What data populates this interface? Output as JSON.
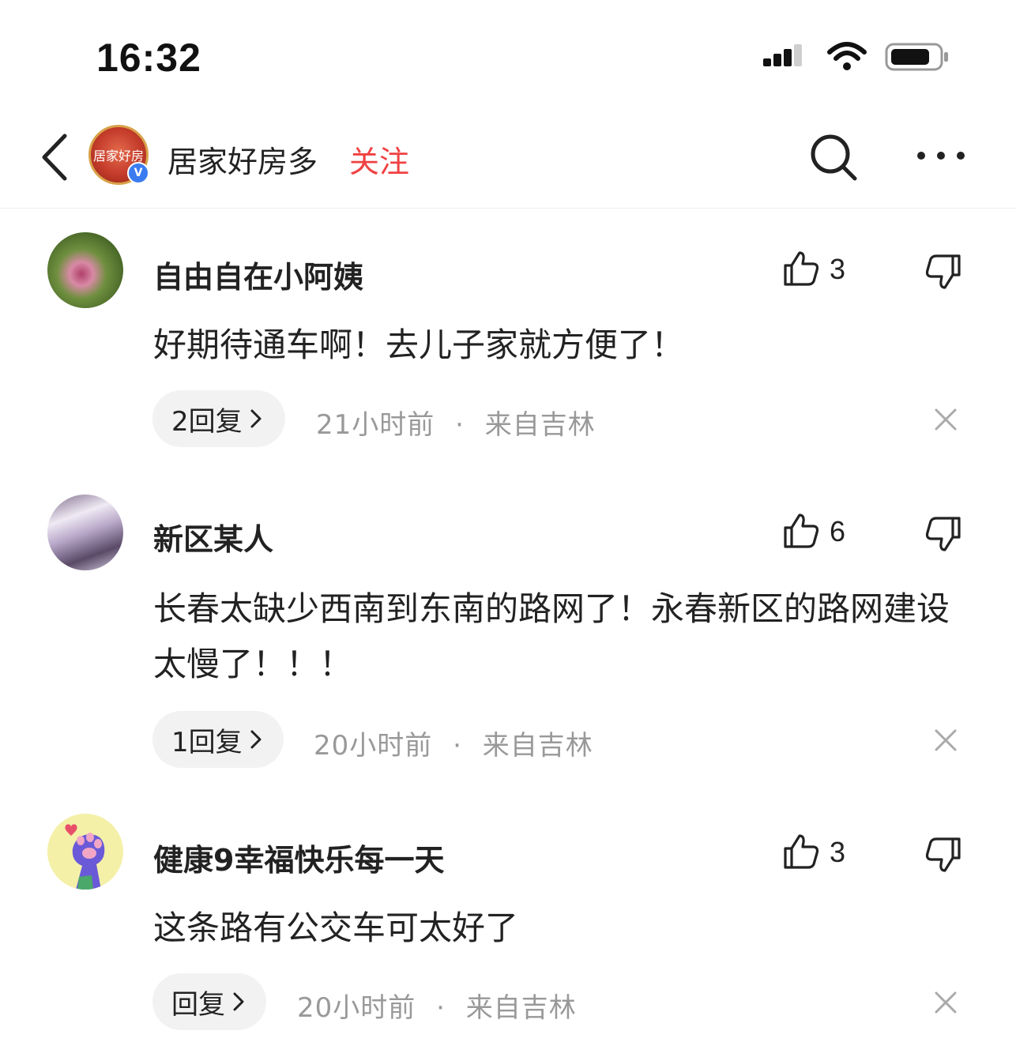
{
  "status_bar": {
    "time": "16:32",
    "icons": [
      "signal-icon",
      "wifi-icon",
      "battery-icon"
    ]
  },
  "header": {
    "account_name": "居家好房多",
    "follow_label": "关注",
    "avatar_text": "居家好房",
    "verified_badge": "V",
    "icons": [
      "back-arrow-icon",
      "search-icon",
      "more-icon"
    ],
    "accent_color": "#f04142"
  },
  "comments": [
    {
      "user": "自由自在小阿姨",
      "text": "好期待通车啊！去儿子家就方便了！",
      "likes": "3",
      "reply_label": "2回复",
      "time": "21小时前",
      "separator": "·",
      "location": "来自吉林"
    },
    {
      "user": "新区某人",
      "text": "长春太缺少西南到东南的路网了！永春新区的路网建设太慢了！！！",
      "likes": "6",
      "reply_label": "1回复",
      "time": "20小时前",
      "separator": "·",
      "location": "来自吉林"
    },
    {
      "user": "健康9幸福快乐每一天",
      "text": "这条路有公交车可太好了",
      "likes": "3",
      "reply_label": "回复",
      "time": "20小时前",
      "separator": "·",
      "location": "来自吉林"
    }
  ]
}
